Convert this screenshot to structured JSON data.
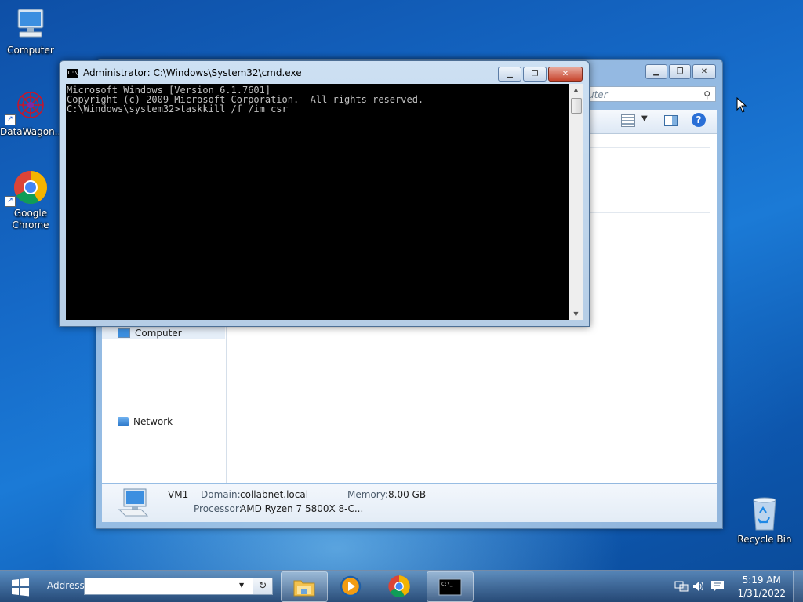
{
  "desktop": {
    "icons": [
      {
        "label": "Computer"
      },
      {
        "label": "DataWagon..."
      },
      {
        "label": "Google Chrome"
      },
      {
        "label": "Recycle Bin"
      }
    ]
  },
  "explorer": {
    "search_placeholder": "uter",
    "nav": {
      "computer": "Computer",
      "network": "Network"
    },
    "details": {
      "name": "VM1",
      "domain_label": "Domain:",
      "domain_value": "collabnet.local",
      "memory_label": "Memory:",
      "memory_value": "8.00 GB",
      "processor_label": "Processor:",
      "processor_value": "AMD Ryzen 7 5800X 8-C..."
    }
  },
  "cmd": {
    "title": "Administrator: C:\\Windows\\System32\\cmd.exe",
    "lines": [
      "Microsoft Windows [Version 6.1.7601]",
      "Copyright (c) 2009 Microsoft Corporation.  All rights reserved.",
      "",
      "C:\\Windows\\system32>taskkill /f /im csr"
    ]
  },
  "taskbar": {
    "address_label": "Address",
    "address_value": "",
    "items": [
      {
        "name": "Windows Explorer",
        "icon": "folder-icon",
        "active": true
      },
      {
        "name": "Windows Media Player",
        "icon": "media-player-icon",
        "active": false
      },
      {
        "name": "Google Chrome",
        "icon": "chrome-icon",
        "active": false
      },
      {
        "name": "Command Prompt",
        "icon": "cmd-icon",
        "active": true
      }
    ],
    "clock_time": "5:19 AM",
    "clock_date": "1/31/2022"
  },
  "colors": {
    "console_bg": "#000000",
    "console_fg": "#c0c0c0",
    "close_button": "#c7452d"
  }
}
